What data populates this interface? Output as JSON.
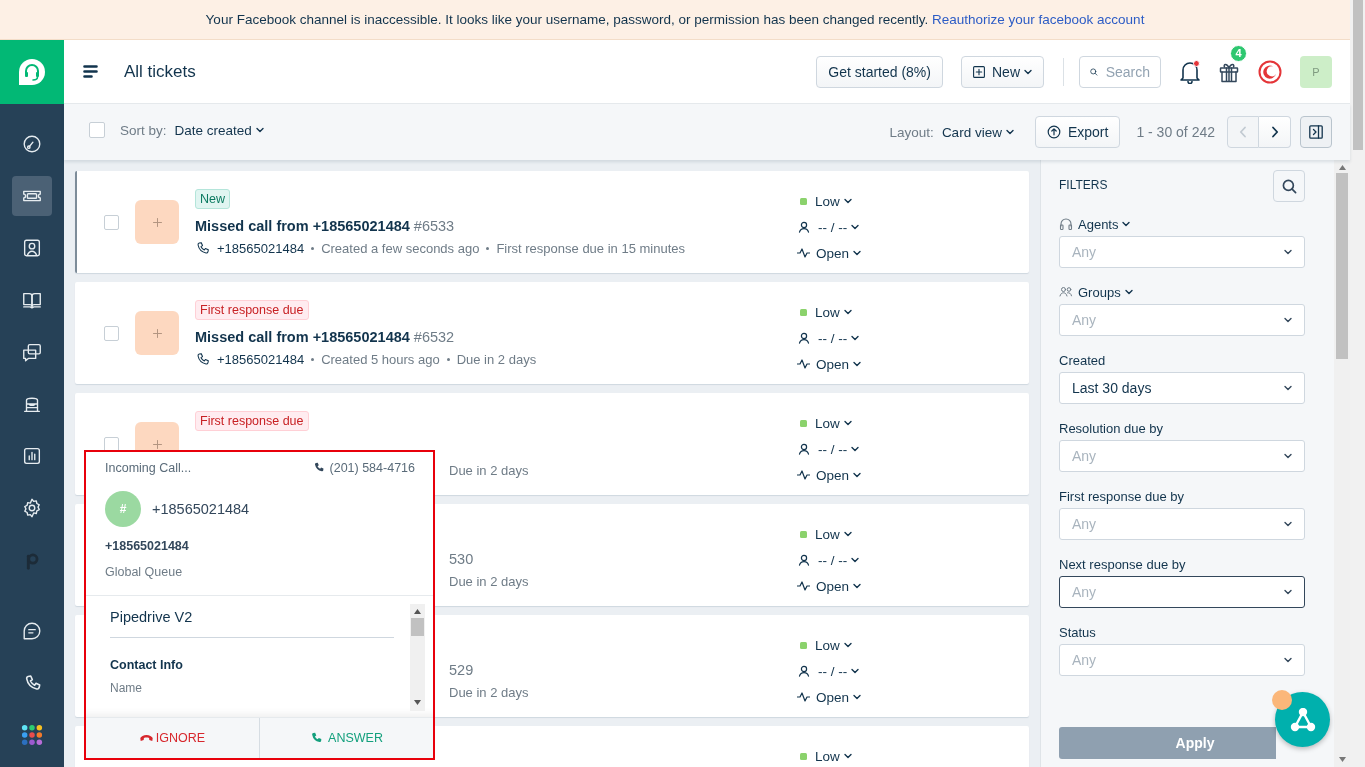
{
  "banner": {
    "message": "Your Facebook channel is inaccessible. It looks like your username, password, or permission has been changed recently.",
    "link": "Reauthorize your facebook account"
  },
  "sidebar": {
    "items": [
      {
        "kind": "dashboard",
        "selected": false
      },
      {
        "kind": "tickets",
        "selected": true
      },
      {
        "kind": "contacts",
        "selected": false
      },
      {
        "kind": "book",
        "selected": false
      },
      {
        "kind": "conversations",
        "selected": false
      },
      {
        "kind": "arch",
        "selected": false
      },
      {
        "kind": "reports",
        "selected": false
      },
      {
        "kind": "settings",
        "selected": false
      },
      {
        "kind": "integration",
        "selected": false
      }
    ],
    "bottom_items": [
      {
        "kind": "message",
        "selected": false
      },
      {
        "kind": "phone",
        "selected": false
      },
      {
        "kind": "apps",
        "selected": false
      }
    ]
  },
  "header": {
    "title": "All tickets",
    "get_started": "Get started (8%)",
    "new_button": "New",
    "search": "Search",
    "notifications_unread": true,
    "gifts_badge": "4",
    "avatar": "P"
  },
  "toolbar": {
    "all_selected": false,
    "sort_label": "Sort by:",
    "sort_value": "Date created",
    "layout_label": "Layout:",
    "layout_value": "Card view",
    "export": "Export",
    "range": "1 - 30 of 242",
    "prev_disabled": true,
    "next_disabled": false
  },
  "tickets": [
    {
      "kind": "full",
      "selected": true,
      "tag": {
        "kind": "new",
        "text": "New"
      },
      "title": "Missed call from +18565021484",
      "number": "#6533",
      "meta": [
        {
          "kind": "phone",
          "text": "+18565021484"
        },
        {
          "kind": "info",
          "text": "Created a few seconds ago"
        },
        {
          "kind": "info",
          "text": "First response due in 15 minutes"
        }
      ],
      "properties": [
        {
          "kind": "priority",
          "text": "Low",
          "color": "#8bd26c"
        },
        {
          "kind": "agent",
          "text": "-- / --"
        },
        {
          "kind": "status",
          "text": "Open"
        }
      ]
    },
    {
      "kind": "full",
      "selected": false,
      "tag": {
        "kind": "overdue",
        "text": "First response due"
      },
      "title": "Missed call from +18565021484",
      "number": "#6532",
      "meta": [
        {
          "kind": "phone",
          "text": "+18565021484"
        },
        {
          "kind": "info",
          "text": "Created 5 hours ago"
        },
        {
          "kind": "info",
          "text": "Due in 2 days"
        }
      ],
      "properties": [
        {
          "kind": "priority",
          "text": "Low",
          "color": "#8bd26c"
        },
        {
          "kind": "agent",
          "text": "-- / --"
        },
        {
          "kind": "status",
          "text": "Open"
        }
      ]
    },
    {
      "kind": "partial",
      "selected": false,
      "tag": {
        "kind": "overdue",
        "text": "First response due"
      },
      "meta": [
        {
          "kind": "info",
          "text": "Due in 2 days"
        }
      ],
      "properties": [
        {
          "kind": "priority",
          "text": "Low",
          "color": "#8bd26c"
        },
        {
          "kind": "agent",
          "text": "-- / --"
        },
        {
          "kind": "status",
          "text": "Open"
        }
      ]
    },
    {
      "kind": "covered",
      "selected": false,
      "title_tail": "530",
      "meta": [
        {
          "kind": "info",
          "text": "Due in 2 days"
        }
      ],
      "properties": [
        {
          "kind": "priority",
          "text": "Low",
          "color": "#8bd26c"
        },
        {
          "kind": "agent",
          "text": "-- / --"
        },
        {
          "kind": "status",
          "text": "Open"
        }
      ]
    },
    {
      "kind": "covered",
      "selected": false,
      "title_tail": "529",
      "meta": [
        {
          "kind": "info",
          "text": "Due in 2 days"
        }
      ],
      "properties": [
        {
          "kind": "priority",
          "text": "Low",
          "color": "#8bd26c"
        },
        {
          "kind": "agent",
          "text": "-- / --"
        },
        {
          "kind": "status",
          "text": "Open"
        }
      ]
    },
    {
      "kind": "covered",
      "selected": false,
      "properties": [
        {
          "kind": "priority",
          "text": "Low",
          "color": "#8bd26c"
        }
      ]
    }
  ],
  "call_popup": {
    "status": "Incoming Call...",
    "line": "(201) 584-4716",
    "avatar": "#",
    "caller": "+18565021484",
    "caller_name": "+18565021484",
    "queue": "Global Queue",
    "integration": "Pipedrive V2",
    "section": "Contact Info",
    "field_label": "Name",
    "ignore": "IGNORE",
    "answer": "ANSWER"
  },
  "filters": {
    "title": "FILTERS",
    "fields": [
      {
        "kind": "agents",
        "label": "Agents",
        "placeholder": "Any",
        "focused": false
      },
      {
        "kind": "groups",
        "label": "Groups",
        "placeholder": "Any",
        "focused": false
      },
      {
        "kind": "plain",
        "label": "Created",
        "value": "Last 30 days",
        "focused": false
      },
      {
        "kind": "plain",
        "label": "Resolution due by",
        "placeholder": "Any",
        "focused": false
      },
      {
        "kind": "plain",
        "label": "First response due by",
        "placeholder": "Any",
        "focused": false
      },
      {
        "kind": "plain",
        "label": "Next response due by",
        "placeholder": "Any",
        "focused": true
      },
      {
        "kind": "plain",
        "label": "Status",
        "placeholder": "Any",
        "focused": false
      }
    ],
    "apply": "Apply"
  }
}
